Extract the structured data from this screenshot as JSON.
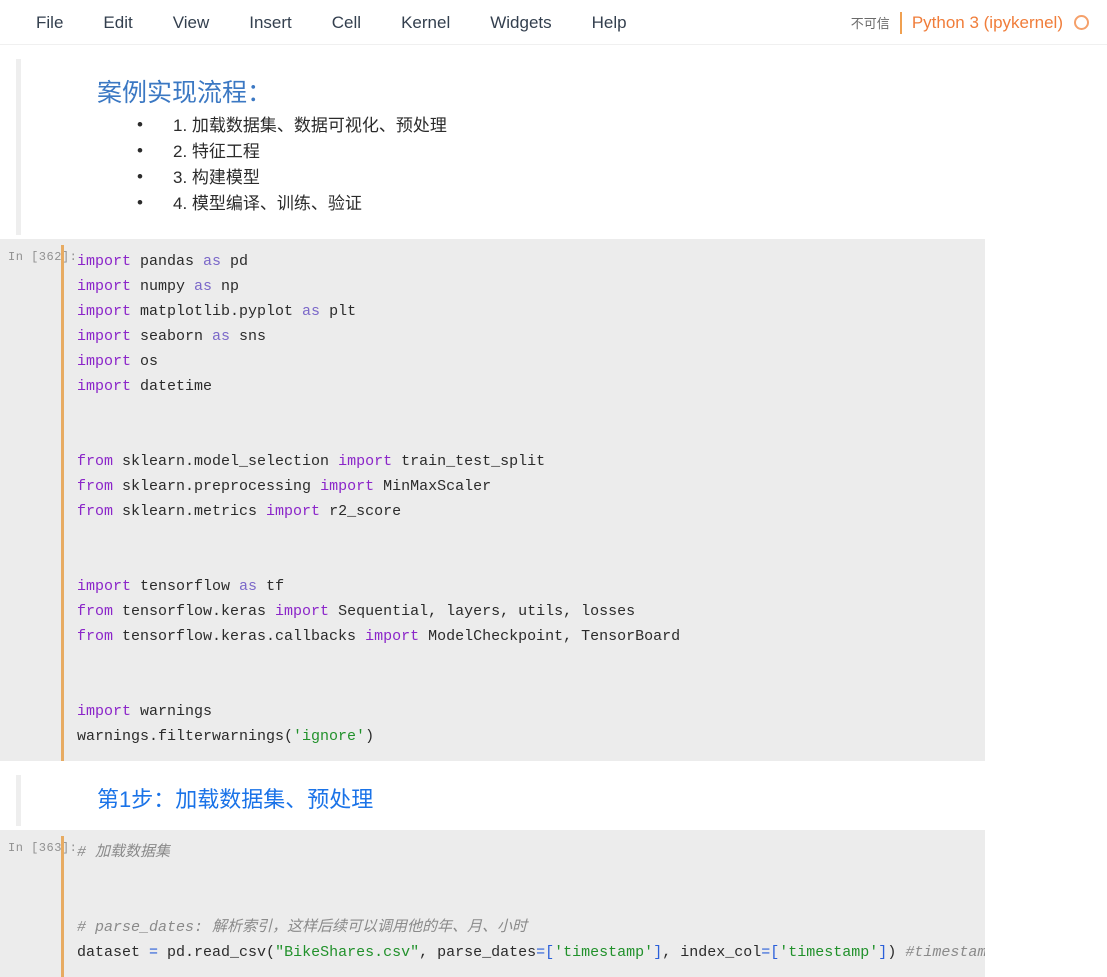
{
  "menubar": {
    "items": [
      {
        "label": "File"
      },
      {
        "label": "Edit"
      },
      {
        "label": "View"
      },
      {
        "label": "Insert"
      },
      {
        "label": "Cell"
      },
      {
        "label": "Kernel"
      },
      {
        "label": "Widgets"
      },
      {
        "label": "Help"
      }
    ],
    "trust_status": "不可信",
    "kernel_name": "Python 3 (ipykernel)",
    "kernel_idle_icon": "circle-idle-icon",
    "separator_color": "#f0a050",
    "kernel_text_color": "#f07d3a"
  },
  "cells": [
    {
      "type": "markdown",
      "heading": "案例实现流程：",
      "heading_color": "#3b78c3",
      "list_items": [
        "1. 加载数据集、数据可视化、预处理",
        "2. 特征工程",
        "3. 构建模型",
        "4. 模型编译、训练、验证"
      ]
    },
    {
      "type": "code",
      "prompt": "In  [362]:",
      "execution_count": 362,
      "selected": true,
      "lines": [
        {
          "tokens": [
            {
              "t": "import",
              "c": "k"
            },
            {
              "t": " pandas ",
              "c": ""
            },
            {
              "t": "as",
              "c": "kw"
            },
            {
              "t": " pd",
              "c": ""
            }
          ]
        },
        {
          "tokens": [
            {
              "t": "import",
              "c": "k"
            },
            {
              "t": " numpy ",
              "c": ""
            },
            {
              "t": "as",
              "c": "kw"
            },
            {
              "t": " np",
              "c": ""
            }
          ]
        },
        {
          "tokens": [
            {
              "t": "import",
              "c": "k"
            },
            {
              "t": " matplotlib.pyplot ",
              "c": ""
            },
            {
              "t": "as",
              "c": "kw"
            },
            {
              "t": " plt",
              "c": ""
            }
          ]
        },
        {
          "tokens": [
            {
              "t": "import",
              "c": "k"
            },
            {
              "t": " seaborn ",
              "c": ""
            },
            {
              "t": "as",
              "c": "kw"
            },
            {
              "t": " sns",
              "c": ""
            }
          ]
        },
        {
          "tokens": [
            {
              "t": "import",
              "c": "k"
            },
            {
              "t": " os",
              "c": ""
            }
          ]
        },
        {
          "tokens": [
            {
              "t": "import",
              "c": "k"
            },
            {
              "t": " datetime",
              "c": ""
            }
          ]
        },
        {
          "tokens": []
        },
        {
          "tokens": []
        },
        {
          "tokens": [
            {
              "t": "from",
              "c": "k"
            },
            {
              "t": " sklearn.model_selection ",
              "c": ""
            },
            {
              "t": "import",
              "c": "k"
            },
            {
              "t": " train_test_split",
              "c": ""
            }
          ]
        },
        {
          "tokens": [
            {
              "t": "from",
              "c": "k"
            },
            {
              "t": " sklearn.preprocessing ",
              "c": ""
            },
            {
              "t": "import",
              "c": "k"
            },
            {
              "t": " MinMaxScaler",
              "c": ""
            }
          ]
        },
        {
          "tokens": [
            {
              "t": "from",
              "c": "k"
            },
            {
              "t": " sklearn.metrics ",
              "c": ""
            },
            {
              "t": "import",
              "c": "k"
            },
            {
              "t": " r2_score",
              "c": ""
            }
          ]
        },
        {
          "tokens": []
        },
        {
          "tokens": []
        },
        {
          "tokens": [
            {
              "t": "import",
              "c": "k"
            },
            {
              "t": " tensorflow ",
              "c": ""
            },
            {
              "t": "as",
              "c": "kw"
            },
            {
              "t": " tf",
              "c": ""
            }
          ]
        },
        {
          "tokens": [
            {
              "t": "from",
              "c": "k"
            },
            {
              "t": " tensorflow.keras ",
              "c": ""
            },
            {
              "t": "import",
              "c": "k"
            },
            {
              "t": " Sequential, layers, utils, losses",
              "c": ""
            }
          ]
        },
        {
          "tokens": [
            {
              "t": "from",
              "c": "k"
            },
            {
              "t": " tensorflow.keras.callbacks ",
              "c": ""
            },
            {
              "t": "import",
              "c": "k"
            },
            {
              "t": " ModelCheckpoint, TensorBoard",
              "c": ""
            }
          ]
        },
        {
          "tokens": []
        },
        {
          "tokens": []
        },
        {
          "tokens": [
            {
              "t": "import",
              "c": "k"
            },
            {
              "t": " warnings",
              "c": ""
            }
          ]
        },
        {
          "tokens": [
            {
              "t": "warnings.filterwarnings(",
              "c": ""
            },
            {
              "t": "'ignore'",
              "c": "s"
            },
            {
              "t": ")",
              "c": ""
            }
          ]
        }
      ]
    },
    {
      "type": "markdown",
      "heading": "第1步：加载数据集、预处理",
      "heading_color": "#1a73e8",
      "list_items": []
    },
    {
      "type": "code",
      "prompt": "In  [363]:",
      "execution_count": 363,
      "selected": true,
      "lines": [
        {
          "tokens": [
            {
              "t": "# 加载数据集",
              "c": "c"
            }
          ]
        },
        {
          "tokens": []
        },
        {
          "tokens": []
        },
        {
          "tokens": [
            {
              "t": "# parse_dates: 解析索引，这样后续可以调用他的年、月、小时",
              "c": "c"
            }
          ]
        },
        {
          "tokens": [
            {
              "t": "dataset ",
              "c": ""
            },
            {
              "t": "=",
              "c": "op"
            },
            {
              "t": " pd.read_csv(",
              "c": ""
            },
            {
              "t": "\"BikeShares.csv\"",
              "c": "s"
            },
            {
              "t": ", parse_dates",
              "c": ""
            },
            {
              "t": "=",
              "c": "op"
            },
            {
              "t": "[",
              "c": "op"
            },
            {
              "t": "'timestamp'",
              "c": "s"
            },
            {
              "t": "]",
              "c": "op"
            },
            {
              "t": ", index_col",
              "c": ""
            },
            {
              "t": "=",
              "c": "op"
            },
            {
              "t": "[",
              "c": "op"
            },
            {
              "t": "'timestamp'",
              "c": "s"
            },
            {
              "t": "]",
              "c": "op"
            },
            {
              "t": ")",
              "c": ""
            },
            {
              "t": " #timestamp当作索引",
              "c": "c"
            }
          ]
        }
      ]
    }
  ]
}
